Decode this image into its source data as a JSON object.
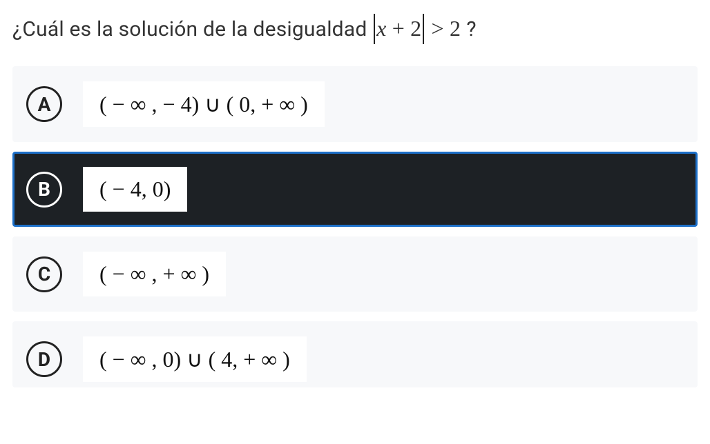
{
  "question": {
    "prefix": "¿Cuál es la solución de la desigualdad ",
    "expr_var": "x",
    "expr_plus": " + 2",
    "expr_gt": " > 2",
    "suffix": " ?"
  },
  "options": [
    {
      "letter": "A",
      "answer": "( − ∞ , − 4) ∪ ( 0,  + ∞ )",
      "selected": false
    },
    {
      "letter": "B",
      "answer": "( − 4, 0)",
      "selected": true
    },
    {
      "letter": "C",
      "answer": "( − ∞ ,  + ∞ )",
      "selected": false
    },
    {
      "letter": "D",
      "answer": "( − ∞ , 0) ∪ ( 4,  + ∞ )",
      "selected": false
    }
  ]
}
